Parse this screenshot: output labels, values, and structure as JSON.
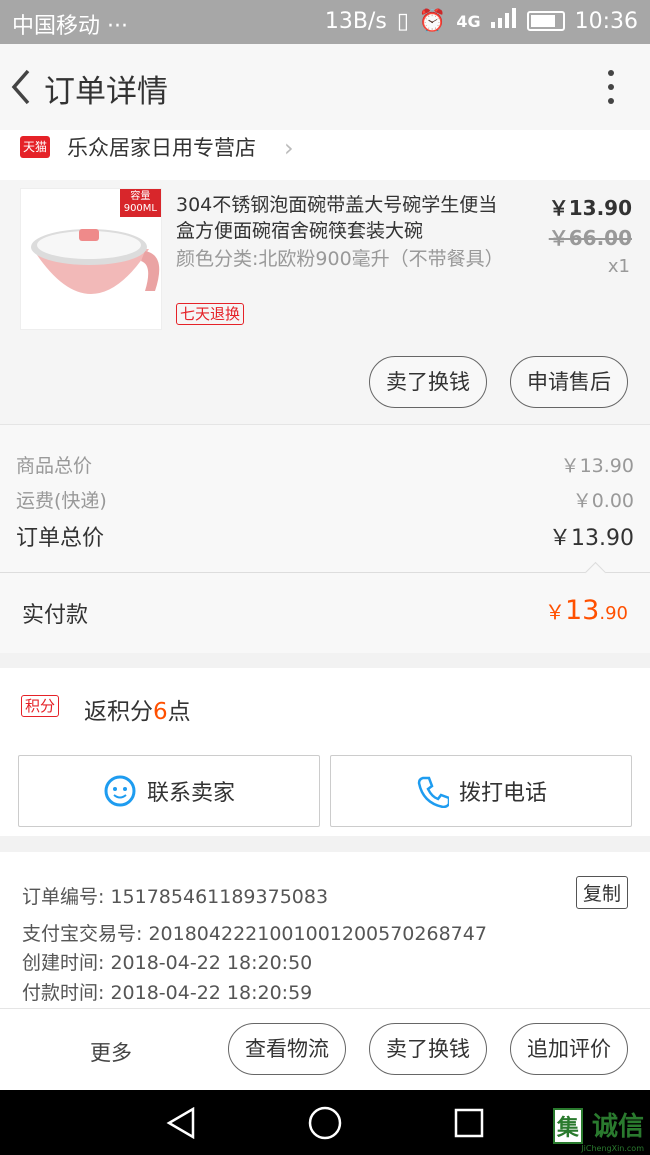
{
  "status_bar": {
    "carrier": "中国移动",
    "dots": "···",
    "speed": "13B/s",
    "network": "4G",
    "time": "10:36"
  },
  "header": {
    "title": "订单详情"
  },
  "shop": {
    "badge": "天猫",
    "name": "乐众居家日用专营店"
  },
  "product": {
    "capacity_badge_top": "容量",
    "capacity_badge_bottom": "900ML",
    "title": "304不锈钢泡面碗带盖大号碗学生便当盒方便面碗宿舍碗筷套装大碗",
    "variant": "颜色分类:北欧粉900毫升（不带餐具）",
    "return_badge": "七天退换",
    "price": "￥13.90",
    "original_price": "￥66.00",
    "quantity": "x1",
    "buttons": {
      "sell": "卖了换钱",
      "after_sale": "申请售后"
    }
  },
  "totals": {
    "goods_label": "商品总价",
    "goods_value": "￥13.90",
    "shipping_label": "运费(快递)",
    "shipping_value": "￥0.00",
    "order_label": "订单总价",
    "order_value": "￥13.90"
  },
  "paid": {
    "label": "实付款",
    "currency": "￥",
    "integer": "13",
    "decimal": ".90",
    "accent": "#ff5000"
  },
  "points": {
    "badge": "积分",
    "prefix": "返积分",
    "count": "6",
    "suffix": "点"
  },
  "contact": {
    "seller": "联系卖家",
    "call": "拨打电话"
  },
  "order_info": {
    "order_no_label": "订单编号:",
    "order_no": "151785461189375083",
    "copy": "复制",
    "alipay_label": "支付宝交易号:",
    "alipay_no": "2018042221001001200570268747",
    "created_label": "创建时间:",
    "created": "2018-04-22 18:20:50",
    "paid_label": "付款时间:",
    "paid_time": "2018-04-22 18:20:59"
  },
  "actions": {
    "more": "更多",
    "logistics": "查看物流",
    "sell": "卖了换钱",
    "review": "追加评价"
  },
  "watermark": {
    "text": "诚信",
    "sub": "JiChengXin.com"
  }
}
